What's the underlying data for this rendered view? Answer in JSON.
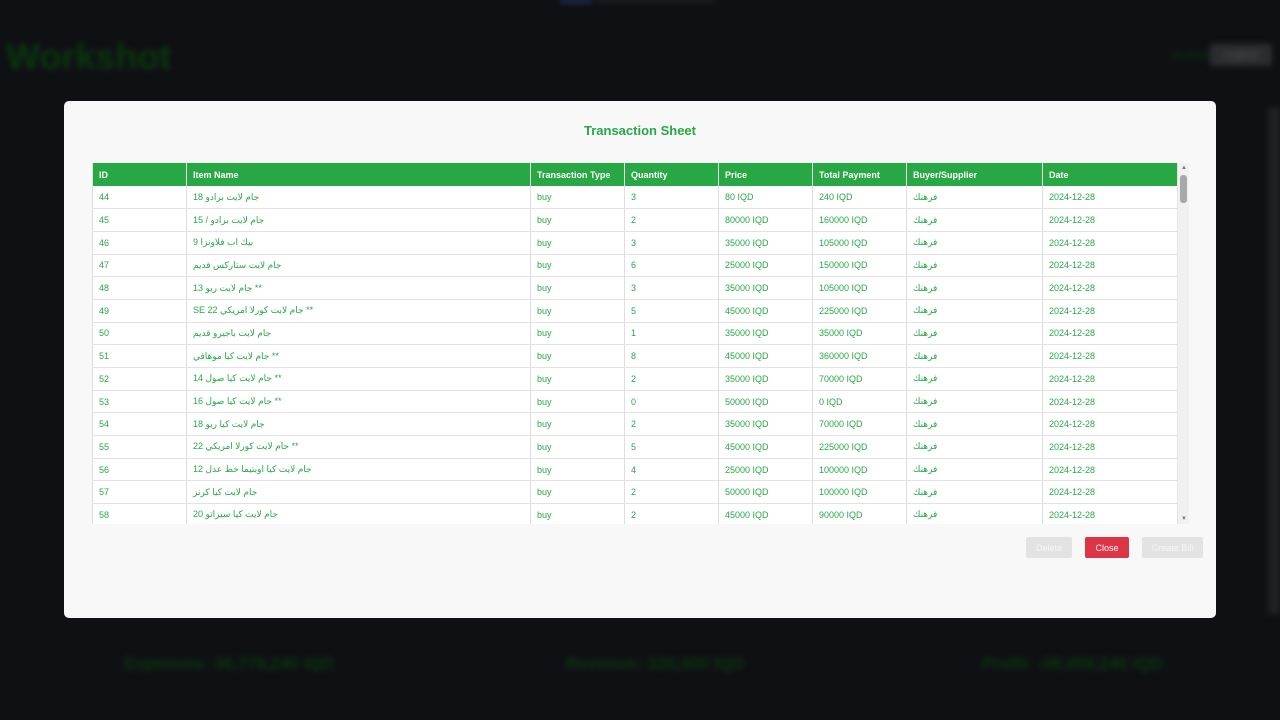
{
  "background": {
    "app_title": "Workshot",
    "user_label": "Andrea",
    "logout_label": "Logout",
    "stats": {
      "expenses": "Expenses: 38,779,240 IQD",
      "revenue": "Revenue: 320,000 IQD",
      "profit": "Profit: -38,459,240 IQD"
    }
  },
  "modal": {
    "title": "Transaction Sheet",
    "columns": [
      "ID",
      "Item Name",
      "Transaction Type",
      "Quantity",
      "Price",
      "Total Payment",
      "Buyer/Supplier",
      "Date"
    ],
    "rows": [
      {
        "id": "44",
        "item": "جام لايت برادو 18",
        "type": "buy",
        "qty": "3",
        "price": "80 IQD",
        "total": "240 IQD",
        "party": "فرهنك",
        "date": "2024-12-28"
      },
      {
        "id": "45",
        "item": "جام لايت برادو / 15",
        "type": "buy",
        "qty": "2",
        "price": "80000 IQD",
        "total": "160000 IQD",
        "party": "فرهنك",
        "date": "2024-12-28"
      },
      {
        "id": "46",
        "item": "بيك اب فلاونزا 9",
        "type": "buy",
        "qty": "3",
        "price": "35000 IQD",
        "total": "105000 IQD",
        "party": "فرهنك",
        "date": "2024-12-28"
      },
      {
        "id": "47",
        "item": "جام لايت ستاركس قديم",
        "type": "buy",
        "qty": "6",
        "price": "25000 IQD",
        "total": "150000 IQD",
        "party": "فرهنك",
        "date": "2024-12-28"
      },
      {
        "id": "48",
        "item": "** جام لايت ريو 13",
        "type": "buy",
        "qty": "3",
        "price": "35000 IQD",
        "total": "105000 IQD",
        "party": "فرهنك",
        "date": "2024-12-28"
      },
      {
        "id": "49",
        "item": "** جام لايت كورلا امريكي SE 22",
        "type": "buy",
        "qty": "5",
        "price": "45000 IQD",
        "total": "225000 IQD",
        "party": "فرهنك",
        "date": "2024-12-28"
      },
      {
        "id": "50",
        "item": "جام لايت باجيرو قديم",
        "type": "buy",
        "qty": "1",
        "price": "35000 IQD",
        "total": "35000 IQD",
        "party": "فرهنك",
        "date": "2024-12-28"
      },
      {
        "id": "51",
        "item": "** جام لايت كيا موهافي",
        "type": "buy",
        "qty": "8",
        "price": "45000 IQD",
        "total": "360000 IQD",
        "party": "فرهنك",
        "date": "2024-12-28"
      },
      {
        "id": "52",
        "item": "** جام لايت كيا صول 14",
        "type": "buy",
        "qty": "2",
        "price": "35000 IQD",
        "total": "70000 IQD",
        "party": "فرهنك",
        "date": "2024-12-28"
      },
      {
        "id": "53",
        "item": "** جام لايت كيا صول 16",
        "type": "buy",
        "qty": "0",
        "price": "50000 IQD",
        "total": "0 IQD",
        "party": "فرهنك",
        "date": "2024-12-28"
      },
      {
        "id": "54",
        "item": "جام لايت كيا ريو 18",
        "type": "buy",
        "qty": "2",
        "price": "35000 IQD",
        "total": "70000 IQD",
        "party": "فرهنك",
        "date": "2024-12-28"
      },
      {
        "id": "55",
        "item": "** جام لايت كورلا امريكي 22",
        "type": "buy",
        "qty": "5",
        "price": "45000 IQD",
        "total": "225000 IQD",
        "party": "فرهنك",
        "date": "2024-12-28"
      },
      {
        "id": "56",
        "item": "جام لايت كيا اوبتيما خط عدل 12",
        "type": "buy",
        "qty": "4",
        "price": "25000 IQD",
        "total": "100000 IQD",
        "party": "فرهنك",
        "date": "2024-12-28"
      },
      {
        "id": "57",
        "item": "جام لايت كيا كرنز",
        "type": "buy",
        "qty": "2",
        "price": "50000 IQD",
        "total": "100000 IQD",
        "party": "فرهنك",
        "date": "2024-12-28"
      },
      {
        "id": "58",
        "item": "جام لايت كيا سيراتو 20",
        "type": "buy",
        "qty": "2",
        "price": "45000 IQD",
        "total": "90000 IQD",
        "party": "فرهنك",
        "date": "2024-12-28"
      }
    ],
    "buttons": {
      "delete": "Delete",
      "close": "Close",
      "create_bill": "Create Bill"
    }
  },
  "colors": {
    "accent_green": "#28a745",
    "close_red": "#dc3545",
    "disabled_gray": "#e3e3e3",
    "page_bg": "#14161b"
  }
}
